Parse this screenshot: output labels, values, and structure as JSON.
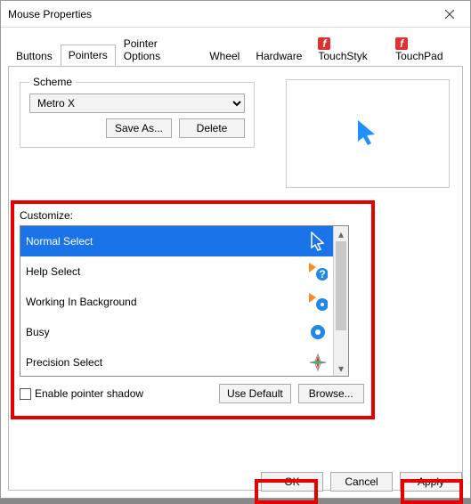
{
  "window": {
    "title": "Mouse Properties"
  },
  "tabs": [
    {
      "label": "Buttons"
    },
    {
      "label": "Pointers"
    },
    {
      "label": "Pointer Options"
    },
    {
      "label": "Wheel"
    },
    {
      "label": "Hardware"
    },
    {
      "label": "TouchStyk"
    },
    {
      "label": "TouchPad"
    }
  ],
  "scheme": {
    "legend": "Scheme",
    "selected": "Metro X",
    "save": "Save As...",
    "del": "Delete"
  },
  "customize": {
    "label": "Customize:",
    "items": [
      {
        "name": "Normal Select"
      },
      {
        "name": "Help Select"
      },
      {
        "name": "Working In Background"
      },
      {
        "name": "Busy"
      },
      {
        "name": "Precision Select"
      }
    ],
    "use_default": "Use Default",
    "browse": "Browse...",
    "shadow": "Enable pointer shadow"
  },
  "buttons": {
    "ok": "OK",
    "cancel": "Cancel",
    "apply": "Apply"
  }
}
